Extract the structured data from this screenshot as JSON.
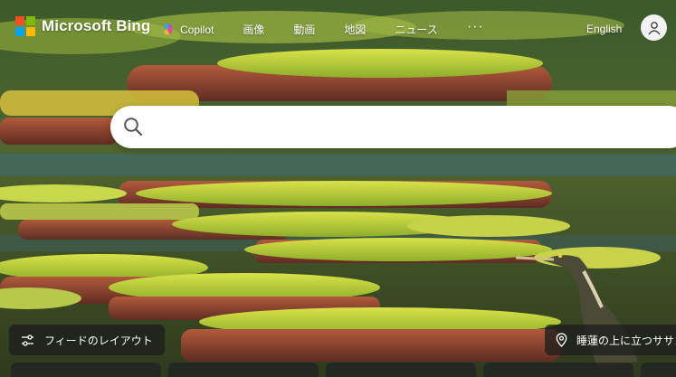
{
  "header": {
    "logo_text": "Microsoft Bing",
    "logo_colors": [
      "#f25022",
      "#7fba00",
      "#00a4ef",
      "#ffb900"
    ],
    "nav": {
      "copilot_label": "Copilot",
      "images_label": "画像",
      "videos_label": "動画",
      "maps_label": "地図",
      "news_label": "ニュース",
      "more_label": "···"
    },
    "language_label": "English"
  },
  "search": {
    "placeholder": "",
    "value": ""
  },
  "footer": {
    "feed_button_label": "フィードのレイアウト",
    "image_info_label": "睡蓮の上に立つササゴイ"
  },
  "background_subject": "water lily pads with heron"
}
